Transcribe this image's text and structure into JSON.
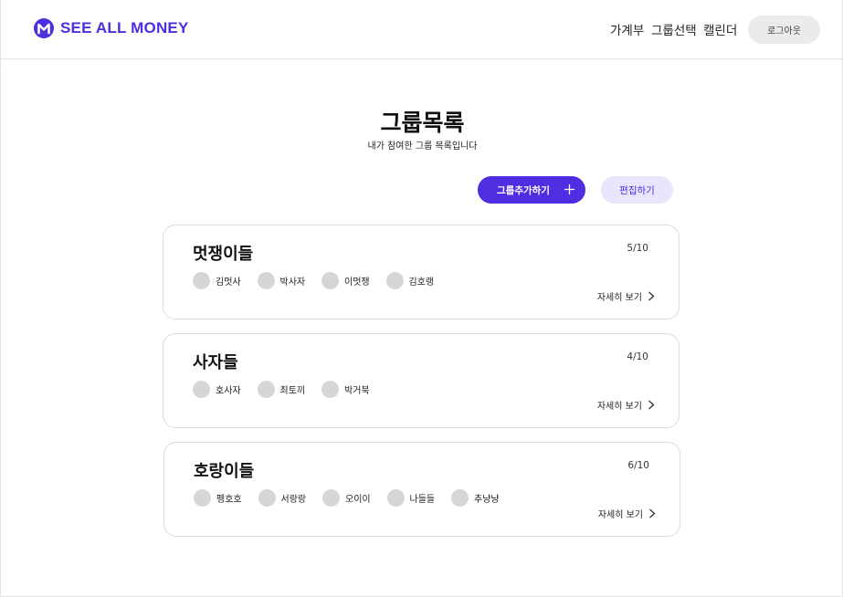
{
  "header": {
    "brand": "SEE ALL MONEY",
    "nav": [
      "가계부",
      "그룹선택",
      "캘린더"
    ],
    "logout": "로그아웃"
  },
  "main": {
    "title": "그룹목록",
    "subtitle": "내가 참여한 그룹 목록입니다",
    "add_button": "그룹추가하기",
    "edit_button": "편집하기"
  },
  "groups": [
    {
      "name": "멋쟁이들",
      "count": "5/10",
      "members": [
        "김멋사",
        "박사자",
        "이멋쟁",
        "김호랭"
      ],
      "detail": "자세히 보기"
    },
    {
      "name": "사자들",
      "count": "4/10",
      "members": [
        "호사자",
        "최토끼",
        "박거북"
      ],
      "detail": "자세히 보기"
    },
    {
      "name": "호랑이들",
      "count": "6/10",
      "members": [
        "펭호호",
        "서랑랑",
        "오이이",
        "나들들",
        "추냥냥"
      ],
      "detail": "자세히 보기"
    }
  ],
  "colors": {
    "accent": "#4f2de0",
    "accent_light": "#e8e5fc",
    "avatar": "#d6d6d6"
  },
  "icons": {
    "logo": "brand-logo-icon",
    "add": "plus-icon",
    "detail": "chevron-right-icon"
  }
}
